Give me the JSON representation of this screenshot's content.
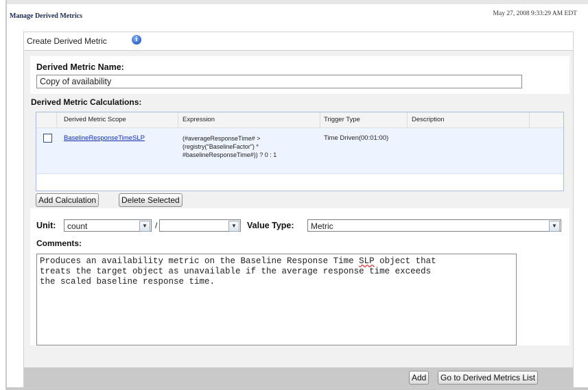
{
  "header": {
    "page_title": "Manage Derived Metrics",
    "timestamp": "May 27, 2008 9:33:29 AM EDT"
  },
  "tab": {
    "label": "Create Derived Metric",
    "info_icon": "info-icon"
  },
  "form": {
    "name_label": "Derived Metric Name:",
    "name_value": "Copy of availability",
    "calculations_label": "Derived Metric Calculations:",
    "columns": [
      "Derived Metric Scope",
      "Expression",
      "Trigger Type",
      "Description"
    ],
    "rows": [
      {
        "scope": "BaselineResponseTimeSLP",
        "expression_lines": [
          "(#averageResponseTime# >",
          "(registry(\"BaselineFactor\") *",
          "#baselineResponseTime#)) ? 0 : 1"
        ],
        "trigger": "Time Driven(00:01:00)",
        "description": ""
      }
    ],
    "add_calculation": "Add Calculation",
    "delete_selected": "Delete Selected",
    "unit_label": "Unit:",
    "unit_value": "count",
    "unit_separator": "/",
    "unit_per_value": "",
    "value_type_label": "Value Type:",
    "value_type_value": "Metric",
    "comments_label": "Comments:",
    "comments_before": "Produces an availability metric on the Baseline Response Time ",
    "comments_spell": "SLP",
    "comments_after": " object that\ntreats the target object as unavailable if the average response time exceeds\nthe scaled baseline response time."
  },
  "footer": {
    "add": "Add",
    "go_to_list": "Go to Derived Metrics List"
  },
  "colors": {
    "link": "#0f2bb8",
    "row_highlight": "#edf3ff",
    "grid_border": "#a9bddc",
    "footer_bg": "#c9c9c9"
  }
}
